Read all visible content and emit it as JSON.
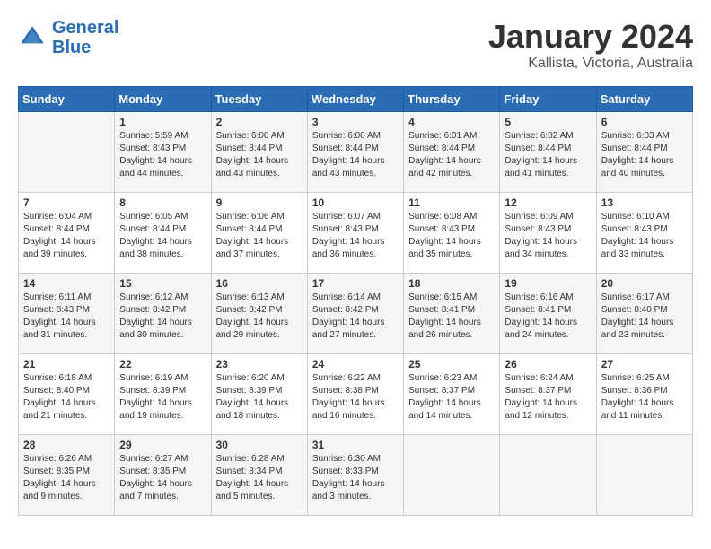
{
  "header": {
    "logo_line1": "General",
    "logo_line2": "Blue",
    "month": "January 2024",
    "location": "Kallista, Victoria, Australia"
  },
  "columns": [
    "Sunday",
    "Monday",
    "Tuesday",
    "Wednesday",
    "Thursday",
    "Friday",
    "Saturday"
  ],
  "weeks": [
    [
      {
        "day": "",
        "info": ""
      },
      {
        "day": "1",
        "info": "Sunrise: 5:59 AM\nSunset: 8:43 PM\nDaylight: 14 hours\nand 44 minutes."
      },
      {
        "day": "2",
        "info": "Sunrise: 6:00 AM\nSunset: 8:44 PM\nDaylight: 14 hours\nand 43 minutes."
      },
      {
        "day": "3",
        "info": "Sunrise: 6:00 AM\nSunset: 8:44 PM\nDaylight: 14 hours\nand 43 minutes."
      },
      {
        "day": "4",
        "info": "Sunrise: 6:01 AM\nSunset: 8:44 PM\nDaylight: 14 hours\nand 42 minutes."
      },
      {
        "day": "5",
        "info": "Sunrise: 6:02 AM\nSunset: 8:44 PM\nDaylight: 14 hours\nand 41 minutes."
      },
      {
        "day": "6",
        "info": "Sunrise: 6:03 AM\nSunset: 8:44 PM\nDaylight: 14 hours\nand 40 minutes."
      }
    ],
    [
      {
        "day": "7",
        "info": "Sunrise: 6:04 AM\nSunset: 8:44 PM\nDaylight: 14 hours\nand 39 minutes."
      },
      {
        "day": "8",
        "info": "Sunrise: 6:05 AM\nSunset: 8:44 PM\nDaylight: 14 hours\nand 38 minutes."
      },
      {
        "day": "9",
        "info": "Sunrise: 6:06 AM\nSunset: 8:44 PM\nDaylight: 14 hours\nand 37 minutes."
      },
      {
        "day": "10",
        "info": "Sunrise: 6:07 AM\nSunset: 8:43 PM\nDaylight: 14 hours\nand 36 minutes."
      },
      {
        "day": "11",
        "info": "Sunrise: 6:08 AM\nSunset: 8:43 PM\nDaylight: 14 hours\nand 35 minutes."
      },
      {
        "day": "12",
        "info": "Sunrise: 6:09 AM\nSunset: 8:43 PM\nDaylight: 14 hours\nand 34 minutes."
      },
      {
        "day": "13",
        "info": "Sunrise: 6:10 AM\nSunset: 8:43 PM\nDaylight: 14 hours\nand 33 minutes."
      }
    ],
    [
      {
        "day": "14",
        "info": "Sunrise: 6:11 AM\nSunset: 8:43 PM\nDaylight: 14 hours\nand 31 minutes."
      },
      {
        "day": "15",
        "info": "Sunrise: 6:12 AM\nSunset: 8:42 PM\nDaylight: 14 hours\nand 30 minutes."
      },
      {
        "day": "16",
        "info": "Sunrise: 6:13 AM\nSunset: 8:42 PM\nDaylight: 14 hours\nand 29 minutes."
      },
      {
        "day": "17",
        "info": "Sunrise: 6:14 AM\nSunset: 8:42 PM\nDaylight: 14 hours\nand 27 minutes."
      },
      {
        "day": "18",
        "info": "Sunrise: 6:15 AM\nSunset: 8:41 PM\nDaylight: 14 hours\nand 26 minutes."
      },
      {
        "day": "19",
        "info": "Sunrise: 6:16 AM\nSunset: 8:41 PM\nDaylight: 14 hours\nand 24 minutes."
      },
      {
        "day": "20",
        "info": "Sunrise: 6:17 AM\nSunset: 8:40 PM\nDaylight: 14 hours\nand 23 minutes."
      }
    ],
    [
      {
        "day": "21",
        "info": "Sunrise: 6:18 AM\nSunset: 8:40 PM\nDaylight: 14 hours\nand 21 minutes."
      },
      {
        "day": "22",
        "info": "Sunrise: 6:19 AM\nSunset: 8:39 PM\nDaylight: 14 hours\nand 19 minutes."
      },
      {
        "day": "23",
        "info": "Sunrise: 6:20 AM\nSunset: 8:39 PM\nDaylight: 14 hours\nand 18 minutes."
      },
      {
        "day": "24",
        "info": "Sunrise: 6:22 AM\nSunset: 8:38 PM\nDaylight: 14 hours\nand 16 minutes."
      },
      {
        "day": "25",
        "info": "Sunrise: 6:23 AM\nSunset: 8:37 PM\nDaylight: 14 hours\nand 14 minutes."
      },
      {
        "day": "26",
        "info": "Sunrise: 6:24 AM\nSunset: 8:37 PM\nDaylight: 14 hours\nand 12 minutes."
      },
      {
        "day": "27",
        "info": "Sunrise: 6:25 AM\nSunset: 8:36 PM\nDaylight: 14 hours\nand 11 minutes."
      }
    ],
    [
      {
        "day": "28",
        "info": "Sunrise: 6:26 AM\nSunset: 8:35 PM\nDaylight: 14 hours\nand 9 minutes."
      },
      {
        "day": "29",
        "info": "Sunrise: 6:27 AM\nSunset: 8:35 PM\nDaylight: 14 hours\nand 7 minutes."
      },
      {
        "day": "30",
        "info": "Sunrise: 6:28 AM\nSunset: 8:34 PM\nDaylight: 14 hours\nand 5 minutes."
      },
      {
        "day": "31",
        "info": "Sunrise: 6:30 AM\nSunset: 8:33 PM\nDaylight: 14 hours\nand 3 minutes."
      },
      {
        "day": "",
        "info": ""
      },
      {
        "day": "",
        "info": ""
      },
      {
        "day": "",
        "info": ""
      }
    ]
  ]
}
